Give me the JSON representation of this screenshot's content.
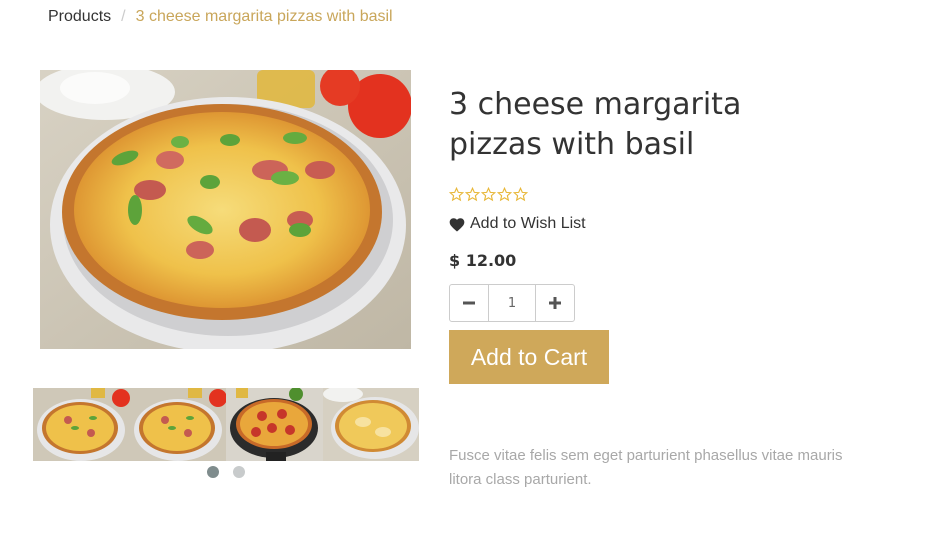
{
  "breadcrumb": {
    "parent": "Products",
    "separator": "/",
    "current": "3 cheese margarita pizzas with basil"
  },
  "product": {
    "title": "3 cheese margarita pizzas with basil",
    "rating_stars": 5,
    "rating_value": 0,
    "wishlist_label": "Add to Wish List",
    "price": "$ 12.00",
    "quantity": "1",
    "add_to_cart_label": "Add to Cart",
    "description": "Fusce vitae felis sem eget parturient phasellus vitae mauris litora class parturient."
  },
  "gallery": {
    "thumbnails": [
      "pizza-basil-thumb",
      "pizza-basil-thumb",
      "pizza-pepperoni-thumb",
      "pizza-cheese-thumb"
    ],
    "dots": 2,
    "active_dot": 0
  },
  "colors": {
    "accent": "#cfa85a",
    "breadcrumb_active": "#c9a65a",
    "star": "#e8b83a"
  }
}
